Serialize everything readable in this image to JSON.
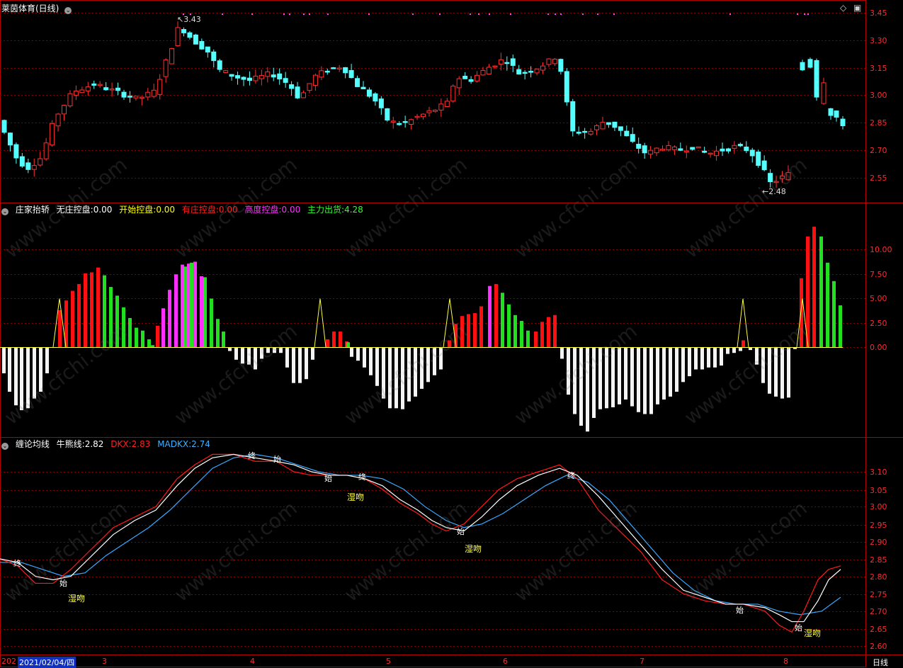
{
  "panels": {
    "price": {
      "title": "莱茵体育(日线)",
      "high_label": "3.43",
      "low_label": "2.48",
      "y_ticks": [
        "3.45",
        "3.30",
        "3.15",
        "3.00",
        "2.85",
        "2.70",
        "2.55"
      ]
    },
    "zhuang": {
      "name": "庄家抬轿",
      "items": [
        {
          "label": "无庄控盘:",
          "value": "0.00",
          "color": "#ffffff"
        },
        {
          "label": "开始控盘:",
          "value": "0.00",
          "color": "#ffff00"
        },
        {
          "label": "有庄控盘:",
          "value": "0.00",
          "color": "#ff2020"
        },
        {
          "label": "高度控盘:",
          "value": "0.00",
          "color": "#ff30ff"
        },
        {
          "label": "主力出货:",
          "value": "4.28",
          "color": "#30ff30"
        }
      ],
      "y_ticks": [
        "10.00",
        "7.50",
        "5.00",
        "2.50",
        "0.00"
      ]
    },
    "chanlun": {
      "name": "缠论均线",
      "items": [
        {
          "label": "牛熊线:",
          "value": "2.82",
          "color": "#ffffff"
        },
        {
          "label": "DKX:",
          "value": "2.83",
          "color": "#ff2020"
        },
        {
          "label": "MADKX:",
          "value": "2.74",
          "color": "#40b0ff"
        }
      ],
      "y_ticks": [
        "3.10",
        "3.05",
        "3.00",
        "2.95",
        "2.90",
        "2.85",
        "2.80",
        "2.75",
        "2.70",
        "2.65",
        "2.60"
      ],
      "markers": {
        "end": "终",
        "start": "始",
        "kiss": "湿吻"
      }
    }
  },
  "x_axis": {
    "cut_label": "202",
    "cursor_date": "2021/02/04/四",
    "months": [
      "3",
      "4",
      "5",
      "6",
      "7",
      "8"
    ],
    "period": "日线"
  },
  "watermark": "www.cfchi.com",
  "colors": {
    "up": "#ff3030",
    "down": "#54ffff",
    "grid": "#8a0000",
    "frame": "#b00000"
  }
}
